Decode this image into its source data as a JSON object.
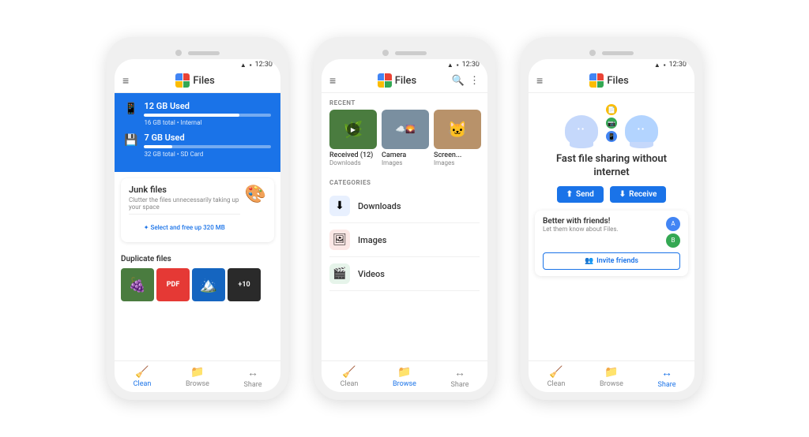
{
  "scene": {
    "bg_color": "#ffffff"
  },
  "phones": [
    {
      "id": "phone1",
      "status": {
        "time": "12:30",
        "signal": "▲",
        "battery": "🔋"
      },
      "header": {
        "menu_icon": "≡",
        "title": "Files"
      },
      "storage": [
        {
          "label": "12 GB Used",
          "progress": 75,
          "sub": "16 GB total • Internal"
        },
        {
          "label": "7 GB Used",
          "progress": 22,
          "sub": "32 GB total • SD Card"
        }
      ],
      "junk": {
        "title": "Junk files",
        "description": "Clutter the files unnecessarily taking up your space",
        "select_btn": "✦ Select and free up 320 MB"
      },
      "duplicates": {
        "title": "Duplicate files",
        "more_count": "+10"
      },
      "nav": [
        {
          "label": "Clean",
          "icon": "🧹",
          "active": true
        },
        {
          "label": "Browse",
          "icon": "📁",
          "active": false
        },
        {
          "label": "Share",
          "icon": "↔",
          "active": false
        }
      ]
    },
    {
      "id": "phone2",
      "status": {
        "time": "12:30",
        "signal": "▲",
        "battery": "🔋"
      },
      "header": {
        "menu_icon": "≡",
        "title": "Files",
        "search_icon": "🔍",
        "more_icon": "⋮"
      },
      "recent_label": "RECENT",
      "recent_items": [
        {
          "name": "Received (12)",
          "sub": "Downloads",
          "type": "video"
        },
        {
          "name": "Camera",
          "sub": "Images",
          "type": "photo"
        },
        {
          "name": "Screen...",
          "sub": "Images",
          "type": "photo2"
        }
      ],
      "categories_label": "CATEGORIES",
      "categories": [
        {
          "name": "Downloads",
          "icon": "⬇",
          "color": "blue"
        },
        {
          "name": "Images",
          "icon": "🖼",
          "color": "red"
        },
        {
          "name": "Videos",
          "icon": "🎬",
          "color": "green"
        }
      ],
      "nav": [
        {
          "label": "Clean",
          "icon": "🧹",
          "active": false
        },
        {
          "label": "Browse",
          "icon": "📁",
          "active": true
        },
        {
          "label": "Share",
          "icon": "↔",
          "active": false
        }
      ]
    },
    {
      "id": "phone3",
      "status": {
        "time": "12:30",
        "signal": "▲",
        "battery": "🔋"
      },
      "header": {
        "menu_icon": "≡",
        "title": "Files"
      },
      "share": {
        "title": "Fast file sharing without internet",
        "send_btn": "Send",
        "receive_btn": "Receive"
      },
      "friends": {
        "title": "Better with friends!",
        "description": "Let them know about Files.",
        "invite_btn": "Invite friends"
      },
      "nav": [
        {
          "label": "Clean",
          "icon": "🧹",
          "active": false
        },
        {
          "label": "Browse",
          "icon": "📁",
          "active": false
        },
        {
          "label": "Share",
          "icon": "↔",
          "active": true
        }
      ]
    }
  ]
}
